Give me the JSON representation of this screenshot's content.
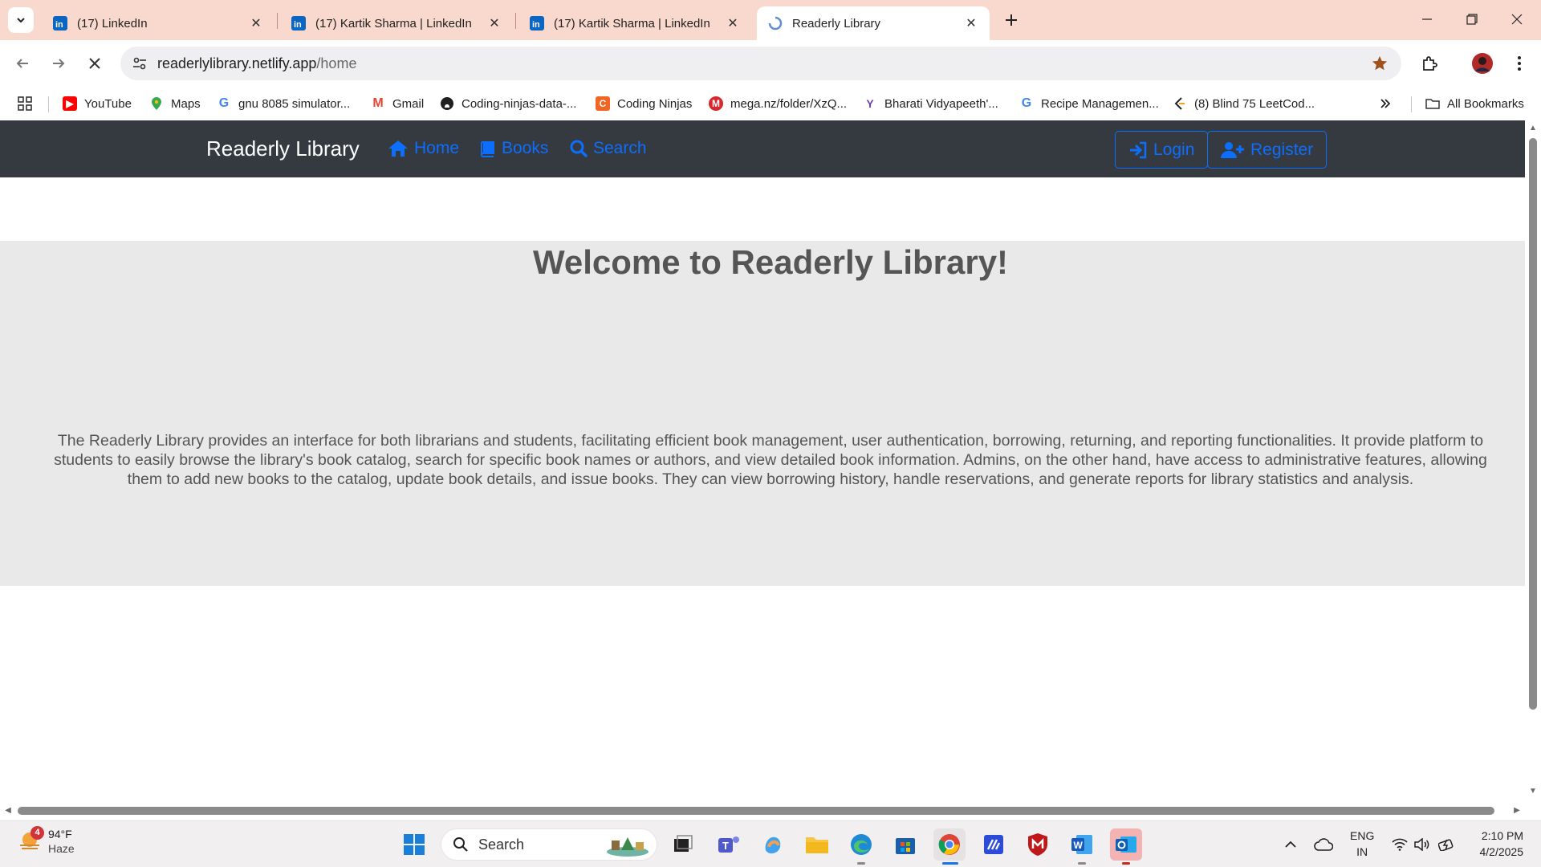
{
  "browser": {
    "tabs": [
      {
        "title": "(17) LinkedIn",
        "icon": "linkedin-icon",
        "active": false
      },
      {
        "title": "(17) Kartik Sharma | LinkedIn",
        "icon": "linkedin-icon",
        "active": false
      },
      {
        "title": "(17) Kartik Sharma | LinkedIn",
        "icon": "linkedin-icon",
        "active": false
      },
      {
        "title": "Readerly Library",
        "icon": "loading-spinner-icon",
        "active": true
      }
    ],
    "url_host": "readerlylibrary.netlify.app",
    "url_path": "/home",
    "bookmarks": [
      {
        "label": "YouTube",
        "icon": "youtube-icon"
      },
      {
        "label": "Maps",
        "icon": "maps-icon"
      },
      {
        "label": "gnu 8085 simulator...",
        "icon": "google-icon"
      },
      {
        "label": "Gmail",
        "icon": "gmail-icon"
      },
      {
        "label": "Coding-ninjas-data-...",
        "icon": "github-icon"
      },
      {
        "label": "Coding Ninjas",
        "icon": "coding-ninjas-icon"
      },
      {
        "label": "mega.nz/folder/XzQ...",
        "icon": "mega-icon"
      },
      {
        "label": "Bharati Vidyapeeth'...",
        "icon": "bharati-icon"
      },
      {
        "label": "Recipe Managemen...",
        "icon": "google-icon"
      },
      {
        "label": "(8) Blind 75 LeetCod...",
        "icon": "leetcode-icon"
      }
    ],
    "all_bookmarks": "All Bookmarks"
  },
  "page": {
    "brand": "Readerly Library",
    "nav": {
      "home": "Home",
      "books": "Books",
      "search": "Search",
      "login": "Login",
      "register": "Register"
    },
    "hero": {
      "title": "Welcome to Readerly Library!",
      "description": "The Readerly Library provides an interface for both librarians and students, facilitating efficient book management, user authentication, borrowing, returning, and reporting functionalities. It provide platform to students to easily browse the library's book catalog, search for specific book names or authors, and view detailed book information. Admins, on the other hand, have access to administrative features, allowing them to add new books to the catalog, update book details, and issue books. They can view borrowing history, handle reservations, and generate reports for library statistics and analysis."
    },
    "colors": {
      "navbar": "#343a40",
      "link": "#0d6efd",
      "hero_bg": "#e9e9e9"
    }
  },
  "taskbar": {
    "weather_temp": "94°F",
    "weather_cond": "Haze",
    "weather_badge": "4",
    "search_label": "Search",
    "lang_line1": "ENG",
    "lang_line2": "IN",
    "time": "2:10 PM",
    "date": "4/2/2025"
  }
}
